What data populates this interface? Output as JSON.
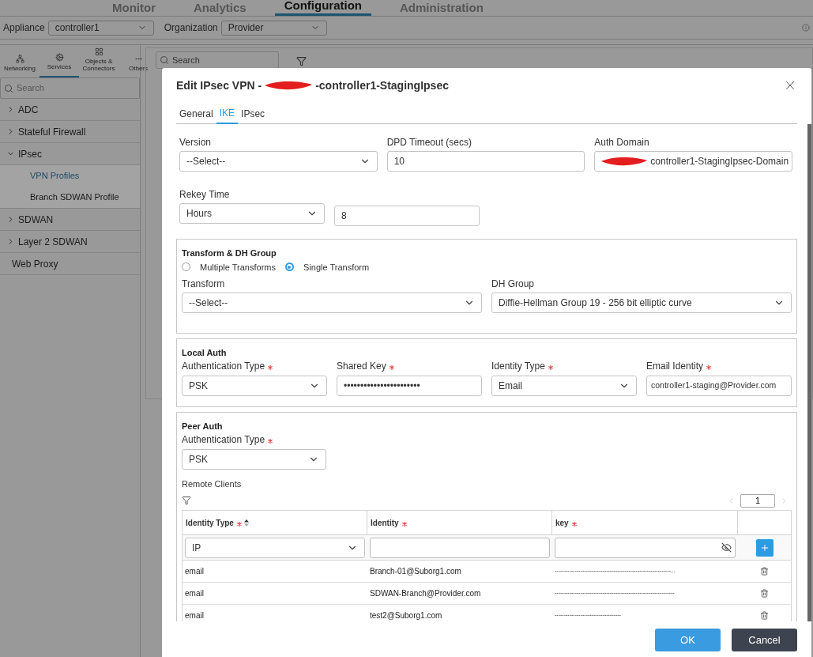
{
  "nav": {
    "tabs": [
      {
        "label": "Monitor",
        "selected": false
      },
      {
        "label": "Analytics",
        "selected": false
      },
      {
        "label": "Configuration",
        "selected": true
      },
      {
        "label": "Administration",
        "selected": false
      }
    ]
  },
  "context": {
    "appliance_label": "Appliance",
    "appliance": "controller1",
    "organization_label": "Organization",
    "organization": "Provider"
  },
  "sidebar": {
    "tabs": [
      {
        "label": "Networking",
        "kind": "network",
        "selected": false
      },
      {
        "label": "Services",
        "kind": "services",
        "selected": true
      },
      {
        "label": "Objects & Connectors",
        "kind": "objects",
        "selected": false
      },
      {
        "label": "Others",
        "kind": "others",
        "selected": false
      }
    ],
    "search_placeholder": "Search",
    "items": [
      {
        "label": "ADC",
        "kind": "group",
        "expanded": false
      },
      {
        "label": "Stateful Firewall",
        "kind": "group",
        "expanded": false
      },
      {
        "label": "IPsec",
        "kind": "group",
        "expanded": true,
        "children": [
          {
            "label": "VPN Profiles",
            "selected": true
          },
          {
            "label": "Branch SDWAN Profile",
            "selected": false
          }
        ]
      },
      {
        "label": "SDWAN",
        "kind": "group",
        "expanded": false
      },
      {
        "label": "Layer 2 SDWAN",
        "kind": "group",
        "expanded": false
      },
      {
        "label": "Web Proxy",
        "kind": "leaf"
      }
    ]
  },
  "background": {
    "search_placeholder": "Search"
  },
  "dialog": {
    "title_prefix": "Edit IPsec VPN -",
    "title_suffix": "-controller1-StagingIpsec",
    "tabs": [
      {
        "label": "General",
        "selected": false
      },
      {
        "label": "IKE",
        "selected": true
      },
      {
        "label": "IPsec",
        "selected": false
      }
    ],
    "version": {
      "label": "Version",
      "value": "--Select--"
    },
    "dpd_timeout": {
      "label": "DPD Timeout (secs)",
      "value": "10"
    },
    "auth_domain": {
      "label": "Auth Domain",
      "value": "controller1-StagingIpsec-Domain"
    },
    "rekey": {
      "label": "Rekey Time",
      "unit": "Hours",
      "value": "8"
    },
    "transform_group": {
      "title": "Transform & DH Group",
      "radios": [
        {
          "label": "Multiple Transforms",
          "selected": false
        },
        {
          "label": "Single Transform",
          "selected": true
        }
      ],
      "transform": {
        "label": "Transform",
        "value": "--Select--"
      },
      "dh_group": {
        "label": "DH Group",
        "value": "Diffie-Hellman Group 19 - 256 bit elliptic curve"
      }
    },
    "local_auth": {
      "title": "Local Auth",
      "fields": [
        {
          "label": "Authentication Type",
          "required": true,
          "kind": "select",
          "value": "PSK"
        },
        {
          "label": "Shared Key",
          "required": true,
          "kind": "password",
          "value": "•••••••••••••••••••••••"
        },
        {
          "label": "Identity Type",
          "required": true,
          "kind": "select",
          "value": "Email"
        },
        {
          "label": "Email Identity",
          "required": true,
          "kind": "text",
          "value": "controller1-staging@Provider.com"
        }
      ]
    },
    "peer_auth": {
      "title": "Peer Auth",
      "auth_type": {
        "label": "Authentication Type",
        "required": true,
        "value": "PSK"
      },
      "remote_clients": {
        "label": "Remote Clients",
        "page": "1",
        "columns": [
          {
            "label": "Identity Type",
            "required": true,
            "sortable": true
          },
          {
            "label": "Identity",
            "required": true,
            "sortable": false
          },
          {
            "label": "key",
            "required": true,
            "sortable": false
          }
        ],
        "new_row": {
          "identity_type": "IP"
        },
        "rows": [
          {
            "identity_type": "email",
            "identity": "Branch-01@Suborg1.com",
            "key": "---------------------------------------------------------------..."
          },
          {
            "identity_type": "email",
            "identity": "SDWAN-Branch@Provider.com",
            "key": "-----------------------------------------------------------------"
          },
          {
            "identity_type": "email",
            "identity": "test2@Suborg1.com",
            "key": "------------------------------------"
          }
        ]
      }
    },
    "buttons": [
      {
        "label": "OK",
        "kind": "primary"
      },
      {
        "label": "Cancel",
        "kind": "secondary"
      }
    ]
  }
}
